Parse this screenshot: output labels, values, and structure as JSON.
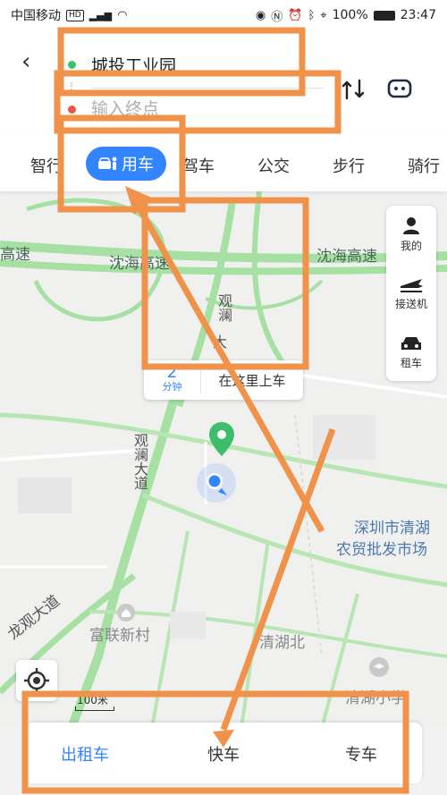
{
  "status_bar": {
    "carrier": "中国移动",
    "hd_tag": "HD",
    "network": "4G",
    "battery": "100%",
    "time": "23:47"
  },
  "route": {
    "start_value": "城投工业园",
    "end_placeholder": "输入终点"
  },
  "tabs": {
    "items": [
      "智行",
      "用车",
      "驾车",
      "公交",
      "步行",
      "骑行"
    ],
    "active": "用车"
  },
  "map_labels": {
    "highway_left": "高速",
    "highway_mid": "沈海高速",
    "highway_right": "沈海高速",
    "road_guanlan_top": "观澜",
    "road_guanlan_top2": "大",
    "road_guanlan_main": "观澜大道",
    "road_longguan": "龙观大道",
    "market": "深圳市清湖\n农贸批发市场",
    "market_l1": "深圳市清湖",
    "market_l2": "农贸批发市场",
    "village": "富联新村",
    "qinghu_north": "清湖北",
    "qinghu_school": "清湖小学"
  },
  "tools": {
    "mine": "我的",
    "pickup": "接送机",
    "rental": "租车"
  },
  "pickup_bubble": {
    "eta_value": "2",
    "eta_unit": "分钟",
    "tip": "在这里上车"
  },
  "scale": "100米",
  "ride_options": {
    "taxi": "出租车",
    "express": "快车",
    "premium": "专车",
    "active": "出租车"
  },
  "colors": {
    "accent": "#3385ff",
    "road_green": "#8fd98a",
    "annotation": "#f0924a"
  }
}
